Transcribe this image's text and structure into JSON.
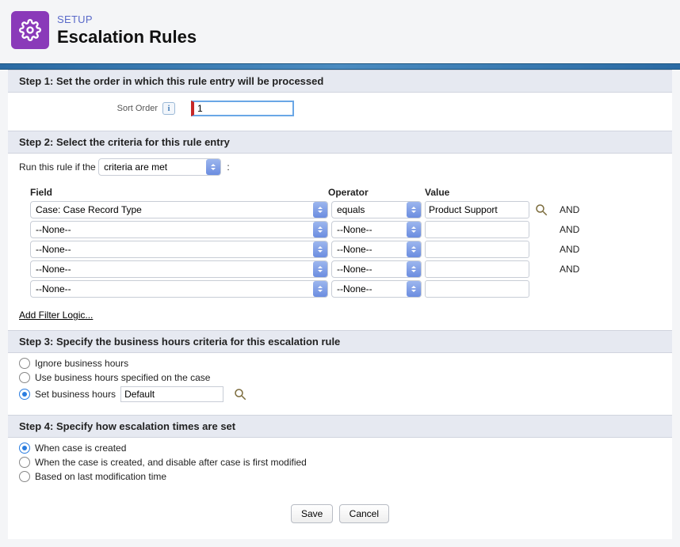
{
  "header": {
    "crumb": "SETUP",
    "title": "Escalation Rules"
  },
  "steps": {
    "s1": "Step 1: Set the order in which this rule entry will be processed",
    "s2": "Step 2: Select the criteria for this rule entry",
    "s3": "Step 3: Specify the business hours criteria for this escalation rule",
    "s4": "Step 4: Specify how escalation times are set"
  },
  "sort": {
    "label": "Sort Order",
    "value": "1"
  },
  "runRule": {
    "prefix": "Run this rule if the",
    "selected": "criteria are met",
    "suffix": ":"
  },
  "criteria": {
    "headers": {
      "field": "Field",
      "operator": "Operator",
      "value": "Value"
    },
    "rows": [
      {
        "field": "Case: Case Record Type",
        "operator": "equals",
        "value": "Product Support",
        "lookup": true,
        "and": "AND"
      },
      {
        "field": "--None--",
        "operator": "--None--",
        "value": "",
        "lookup": false,
        "and": "AND"
      },
      {
        "field": "--None--",
        "operator": "--None--",
        "value": "",
        "lookup": false,
        "and": "AND"
      },
      {
        "field": "--None--",
        "operator": "--None--",
        "value": "",
        "lookup": false,
        "and": "AND"
      },
      {
        "field": "--None--",
        "operator": "--None--",
        "value": "",
        "lookup": false,
        "and": ""
      }
    ],
    "addFilter": "Add Filter Logic..."
  },
  "businessHours": {
    "opt1": "Ignore business hours",
    "opt2": "Use business hours specified on the case",
    "opt3": "Set business hours",
    "value": "Default"
  },
  "escalationTimes": {
    "opt1": "When case is created",
    "opt2": "When the case is created, and disable after case is first modified",
    "opt3": "Based on last modification time"
  },
  "buttons": {
    "save": "Save",
    "cancel": "Cancel"
  }
}
